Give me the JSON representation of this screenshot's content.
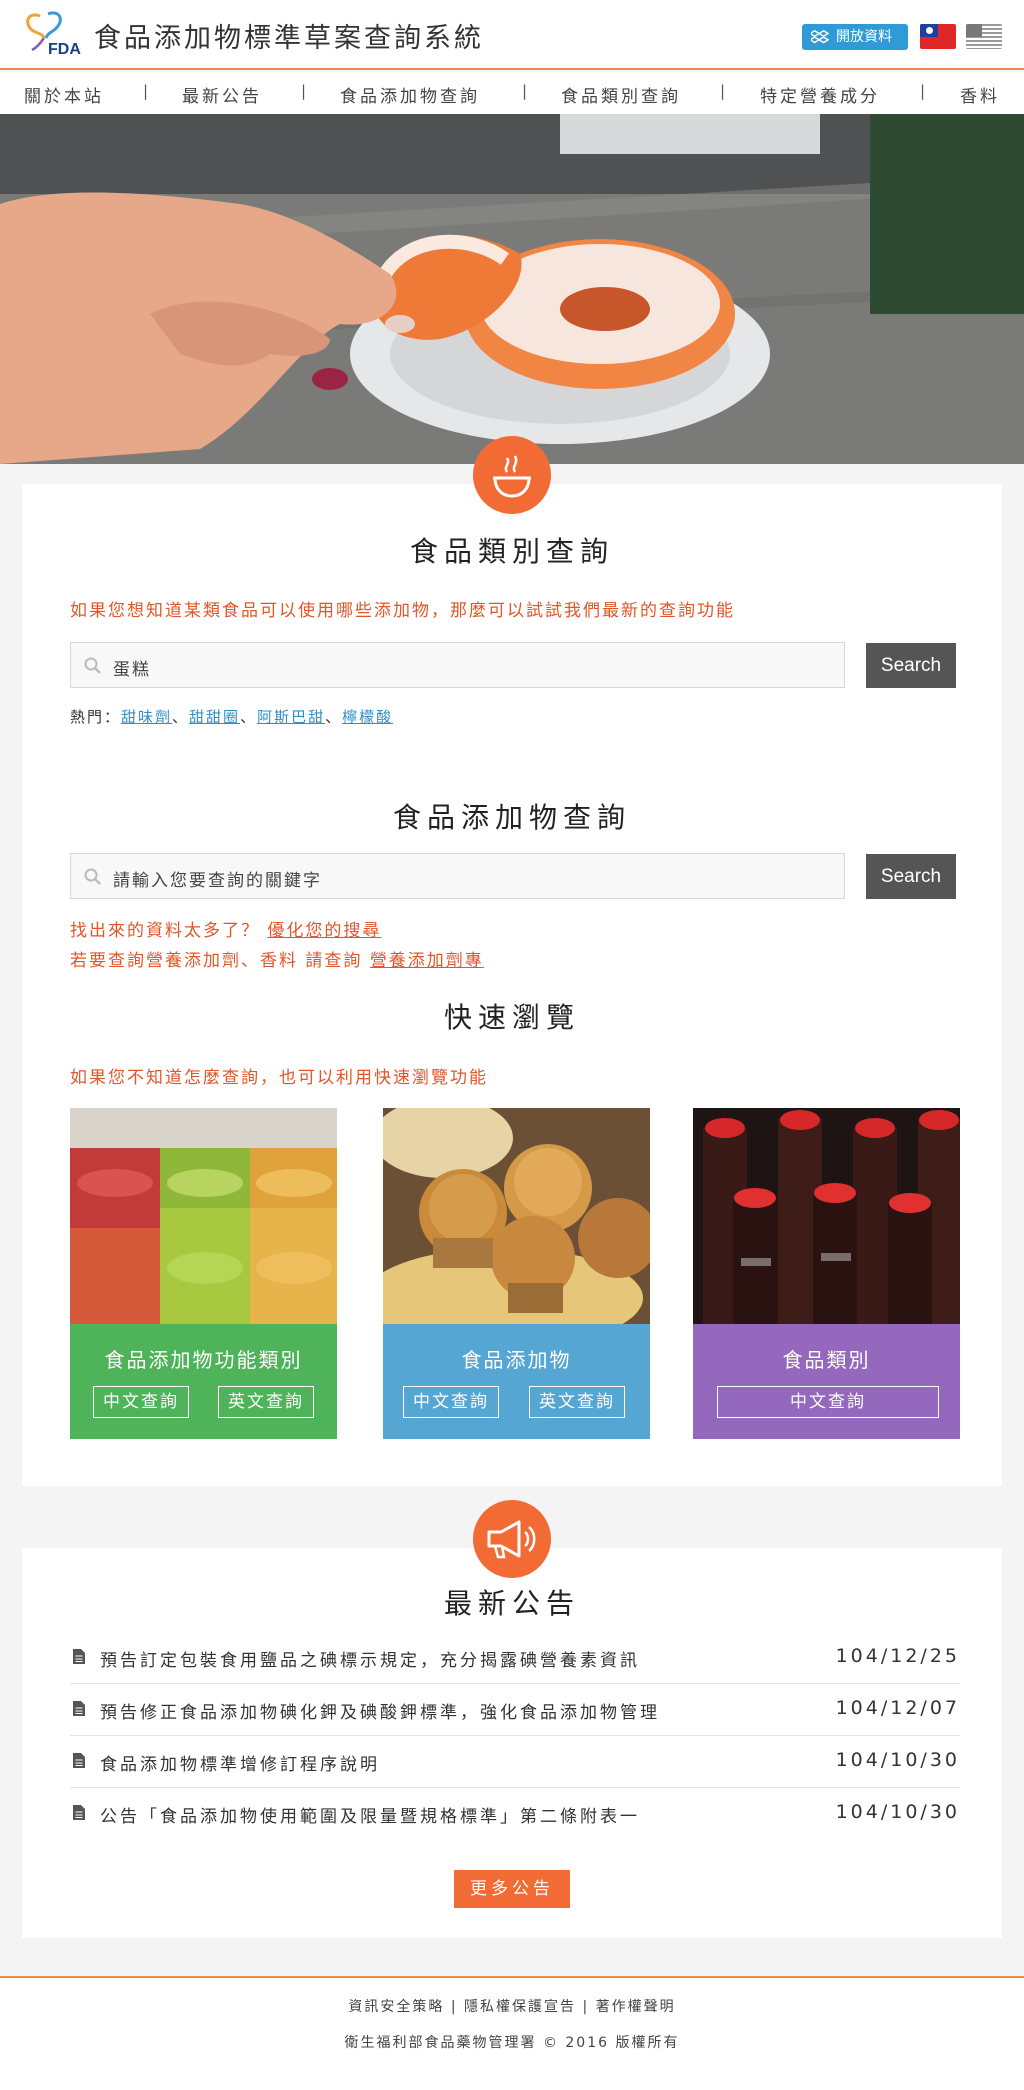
{
  "header": {
    "logo_text": "FDA",
    "site_title": "食品添加物標準草案查詢系統",
    "open_data_label": "開放資料",
    "flags": [
      "flag-taiwan-icon",
      "flag-us-icon"
    ]
  },
  "nav": {
    "items": [
      {
        "label": "關於本站"
      },
      {
        "label": "最新公告"
      },
      {
        "label": "食品添加物查詢"
      },
      {
        "label": "食品類別查詢"
      },
      {
        "label": "特定營養成分"
      },
      {
        "label": "香料"
      }
    ],
    "separator": "|"
  },
  "food_category_search": {
    "icon": "bowl-icon",
    "title": "食品類別查詢",
    "hint": "如果您想知道某類食品可以使用哪些添加物，那麼可以試試我們最新的查詢功能",
    "input_value": "蛋糕",
    "button_label": "Search",
    "hot_label": "熱門：",
    "hot_terms": [
      "甜味劑",
      "甜甜圈",
      "阿斯巴甜",
      "檸檬酸"
    ],
    "hot_separator": "、"
  },
  "additive_search": {
    "title": "食品添加物查詢",
    "placeholder": "請輸入您要查詢的關鍵字",
    "button_label": "Search",
    "refine_text": "找出來的資料太多了？",
    "refine_link": "優化您的搜尋",
    "nutrition_text": "若要查詢營養添加劑、香料 請查詢",
    "nutrition_link": "營養添加劑專"
  },
  "quick_browse": {
    "title": "快速瀏覽",
    "hint": "如果您不知道怎麼查詢，也可以利用快速瀏覽功能",
    "tiles": [
      {
        "title": "食品添加物功能類別",
        "color": "#4fb35a",
        "buttons": [
          "中文查詢",
          "英文查詢"
        ]
      },
      {
        "title": "食品添加物",
        "color": "#55a6d2",
        "buttons": [
          "中文查詢",
          "英文查詢"
        ]
      },
      {
        "title": "食品類別",
        "color": "#9468bd",
        "buttons": [
          "中文查詢"
        ]
      }
    ]
  },
  "news": {
    "icon": "megaphone-icon",
    "title": "最新公告",
    "items": [
      {
        "title": "預告訂定包裝食用鹽品之碘標示規定，充分揭露碘營養素資訊",
        "date": "104/12/25"
      },
      {
        "title": "預告修正食品添加物碘化鉀及碘酸鉀標準，強化食品添加物管理",
        "date": "104/12/07"
      },
      {
        "title": "食品添加物標準增修訂程序說明",
        "date": "104/10/30"
      },
      {
        "title": "公告「食品添加物使用範圍及限量暨規格標準」第二條附表一",
        "date": "104/10/30"
      }
    ],
    "more_label": "更多公告"
  },
  "footer": {
    "links": [
      "資訊安全策略",
      "隱私權保護宣告",
      "著作權聲明"
    ],
    "link_separator": "|",
    "copyright": "衛生福利部食品藥物管理署 © 2016 版權所有"
  },
  "colors": {
    "accent": "#f26b35",
    "hint_red": "#e2562a",
    "button_gray": "#555555",
    "open_data_blue": "#2f9bd6"
  }
}
